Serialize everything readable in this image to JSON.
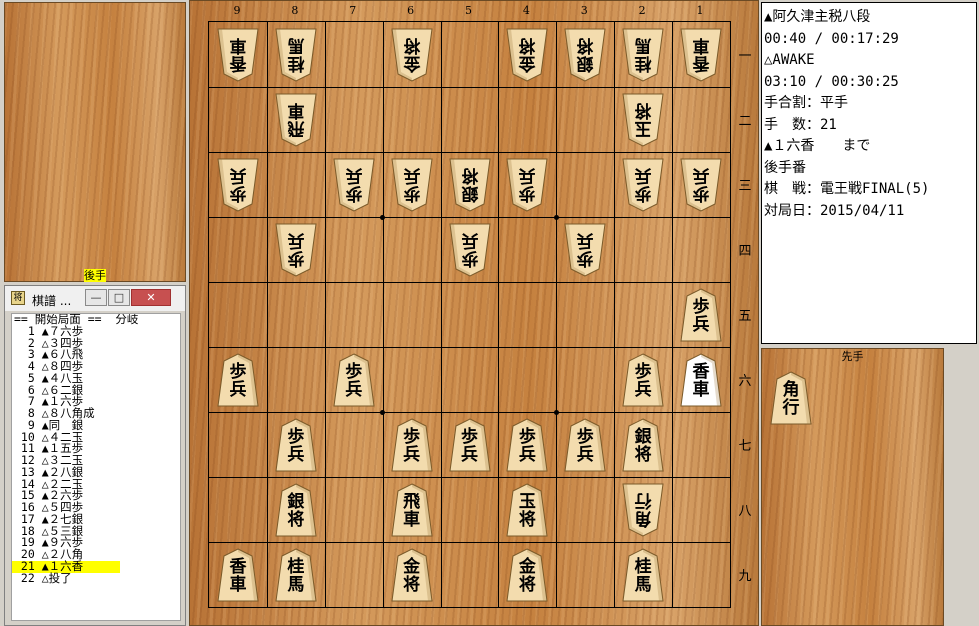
{
  "gote_stand": {
    "label": "後手",
    "pieces": []
  },
  "sente_stand": {
    "label": "先手",
    "pieces": [
      {
        "name": "kaku",
        "chars": [
          "角",
          "行"
        ]
      }
    ]
  },
  "kifu_window": {
    "title": "棋譜 ...",
    "buttons": {
      "minimize": "—",
      "maximize": "□",
      "close": "✕"
    },
    "moves": [
      "== 開始局面 ==  分岐",
      "  1 ▲７六歩",
      "  2 △３四歩",
      "  3 ▲６八飛",
      "  4 △８四歩",
      "  5 ▲４八玉",
      "  6 △６二銀",
      "  7 ▲１六歩",
      "  8 △８八角成",
      "  9 ▲同　銀",
      " 10 △４二玉",
      " 11 ▲１五歩",
      " 12 △３二玉",
      " 13 ▲２八銀",
      " 14 △２二玉",
      " 15 ▲２六歩",
      " 16 △５四歩",
      " 17 ▲２七銀",
      " 18 △５三銀",
      " 19 ▲９六歩",
      " 20 △２八角",
      " 21 ▲１六香",
      " 22 △投了"
    ],
    "selected_index": 21
  },
  "board": {
    "files": [
      "9",
      "8",
      "7",
      "6",
      "5",
      "4",
      "3",
      "2",
      "1"
    ],
    "ranks": [
      "一",
      "二",
      "三",
      "四",
      "五",
      "六",
      "七",
      "八",
      "九"
    ],
    "pieces": [
      {
        "file": 9,
        "rank": 1,
        "side": "gote",
        "chars": [
          "香",
          "車"
        ]
      },
      {
        "file": 8,
        "rank": 1,
        "side": "gote",
        "chars": [
          "桂",
          "馬"
        ]
      },
      {
        "file": 6,
        "rank": 1,
        "side": "gote",
        "chars": [
          "金",
          "将"
        ]
      },
      {
        "file": 4,
        "rank": 1,
        "side": "gote",
        "chars": [
          "金",
          "将"
        ]
      },
      {
        "file": 3,
        "rank": 1,
        "side": "gote",
        "chars": [
          "銀",
          "将"
        ]
      },
      {
        "file": 2,
        "rank": 1,
        "side": "gote",
        "chars": [
          "桂",
          "馬"
        ]
      },
      {
        "file": 1,
        "rank": 1,
        "side": "gote",
        "chars": [
          "香",
          "車"
        ]
      },
      {
        "file": 8,
        "rank": 2,
        "side": "gote",
        "chars": [
          "飛",
          "車"
        ]
      },
      {
        "file": 2,
        "rank": 2,
        "side": "gote",
        "chars": [
          "玉",
          "将"
        ]
      },
      {
        "file": 9,
        "rank": 3,
        "side": "gote",
        "chars": [
          "歩",
          "兵"
        ]
      },
      {
        "file": 7,
        "rank": 3,
        "side": "gote",
        "chars": [
          "歩",
          "兵"
        ]
      },
      {
        "file": 6,
        "rank": 3,
        "side": "gote",
        "chars": [
          "歩",
          "兵"
        ]
      },
      {
        "file": 5,
        "rank": 3,
        "side": "gote",
        "chars": [
          "銀",
          "将"
        ]
      },
      {
        "file": 4,
        "rank": 3,
        "side": "gote",
        "chars": [
          "歩",
          "兵"
        ]
      },
      {
        "file": 2,
        "rank": 3,
        "side": "gote",
        "chars": [
          "歩",
          "兵"
        ]
      },
      {
        "file": 1,
        "rank": 3,
        "side": "gote",
        "chars": [
          "歩",
          "兵"
        ]
      },
      {
        "file": 8,
        "rank": 4,
        "side": "gote",
        "chars": [
          "歩",
          "兵"
        ]
      },
      {
        "file": 5,
        "rank": 4,
        "side": "gote",
        "chars": [
          "歩",
          "兵"
        ]
      },
      {
        "file": 3,
        "rank": 4,
        "side": "gote",
        "chars": [
          "歩",
          "兵"
        ]
      },
      {
        "file": 1,
        "rank": 5,
        "side": "sente",
        "chars": [
          "歩",
          "兵"
        ]
      },
      {
        "file": 9,
        "rank": 6,
        "side": "sente",
        "chars": [
          "歩",
          "兵"
        ]
      },
      {
        "file": 7,
        "rank": 6,
        "side": "sente",
        "chars": [
          "歩",
          "兵"
        ]
      },
      {
        "file": 2,
        "rank": 6,
        "side": "sente",
        "chars": [
          "歩",
          "兵"
        ]
      },
      {
        "file": 1,
        "rank": 6,
        "side": "sente",
        "chars": [
          "香",
          "車"
        ],
        "highlight": true
      },
      {
        "file": 8,
        "rank": 7,
        "side": "sente",
        "chars": [
          "歩",
          "兵"
        ]
      },
      {
        "file": 6,
        "rank": 7,
        "side": "sente",
        "chars": [
          "歩",
          "兵"
        ]
      },
      {
        "file": 5,
        "rank": 7,
        "side": "sente",
        "chars": [
          "歩",
          "兵"
        ]
      },
      {
        "file": 4,
        "rank": 7,
        "side": "sente",
        "chars": [
          "歩",
          "兵"
        ]
      },
      {
        "file": 3,
        "rank": 7,
        "side": "sente",
        "chars": [
          "歩",
          "兵"
        ]
      },
      {
        "file": 2,
        "rank": 7,
        "side": "sente",
        "chars": [
          "銀",
          "将"
        ]
      },
      {
        "file": 8,
        "rank": 8,
        "side": "sente",
        "chars": [
          "銀",
          "将"
        ]
      },
      {
        "file": 6,
        "rank": 8,
        "side": "sente",
        "chars": [
          "飛",
          "車"
        ]
      },
      {
        "file": 4,
        "rank": 8,
        "side": "sente",
        "chars": [
          "玉",
          "将"
        ]
      },
      {
        "file": 2,
        "rank": 8,
        "side": "gote",
        "chars": [
          "角",
          "行"
        ]
      },
      {
        "file": 9,
        "rank": 9,
        "side": "sente",
        "chars": [
          "香",
          "車"
        ]
      },
      {
        "file": 8,
        "rank": 9,
        "side": "sente",
        "chars": [
          "桂",
          "馬"
        ]
      },
      {
        "file": 6,
        "rank": 9,
        "side": "sente",
        "chars": [
          "金",
          "将"
        ]
      },
      {
        "file": 4,
        "rank": 9,
        "side": "sente",
        "chars": [
          "金",
          "将"
        ]
      },
      {
        "file": 2,
        "rank": 9,
        "side": "sente",
        "chars": [
          "桂",
          "馬"
        ]
      }
    ]
  },
  "info": {
    "lines": [
      "▲阿久津主税八段",
      "00:40 / 00:17:29",
      "△AWAKE",
      "03:10 / 00:30:25",
      "手合割：平手",
      "手　数：21",
      "▲１六香　　まで",
      "後手番",
      "棋　戦：電王戦FINAL(5)",
      "対局日：2015/04/11"
    ]
  },
  "colors": {
    "wood": "#c98a4a",
    "piece_face": "#f3dcae",
    "highlight": "#ffff00"
  }
}
